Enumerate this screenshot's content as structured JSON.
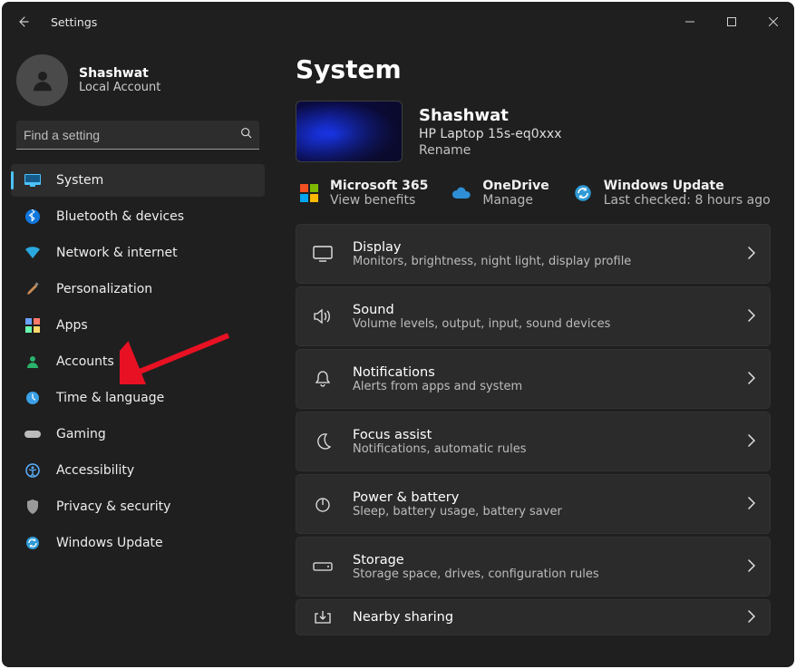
{
  "window": {
    "title": "Settings"
  },
  "user": {
    "name": "Shashwat",
    "account_type": "Local Account"
  },
  "search": {
    "placeholder": "Find a setting"
  },
  "sidebar": {
    "items": [
      {
        "label": "System"
      },
      {
        "label": "Bluetooth & devices"
      },
      {
        "label": "Network & internet"
      },
      {
        "label": "Personalization"
      },
      {
        "label": "Apps"
      },
      {
        "label": "Accounts"
      },
      {
        "label": "Time & language"
      },
      {
        "label": "Gaming"
      },
      {
        "label": "Accessibility"
      },
      {
        "label": "Privacy & security"
      },
      {
        "label": "Windows Update"
      }
    ]
  },
  "page": {
    "title": "System"
  },
  "device": {
    "name": "Shashwat",
    "model": "HP Laptop 15s-eq0xxx",
    "rename_label": "Rename"
  },
  "quicklinks": [
    {
      "title": "Microsoft 365",
      "sub": "View benefits"
    },
    {
      "title": "OneDrive",
      "sub": "Manage"
    },
    {
      "title": "Windows Update",
      "sub": "Last checked: 8 hours ago"
    }
  ],
  "options": [
    {
      "title": "Display",
      "sub": "Monitors, brightness, night light, display profile"
    },
    {
      "title": "Sound",
      "sub": "Volume levels, output, input, sound devices"
    },
    {
      "title": "Notifications",
      "sub": "Alerts from apps and system"
    },
    {
      "title": "Focus assist",
      "sub": "Notifications, automatic rules"
    },
    {
      "title": "Power & battery",
      "sub": "Sleep, battery usage, battery saver"
    },
    {
      "title": "Storage",
      "sub": "Storage space, drives, configuration rules"
    },
    {
      "title": "Nearby sharing",
      "sub": ""
    }
  ]
}
